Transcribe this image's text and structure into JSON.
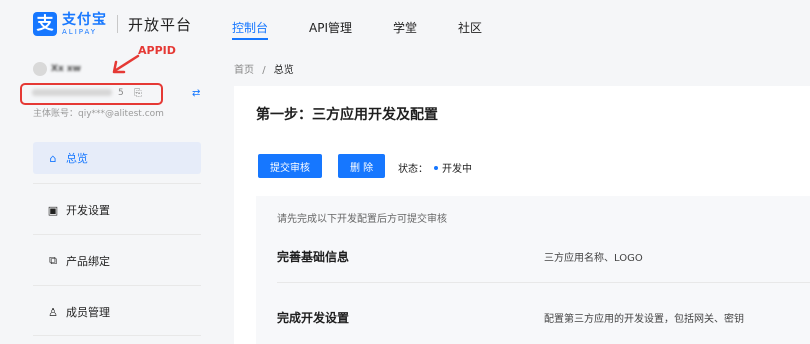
{
  "logo": {
    "cn": "支付宝",
    "en": "ALIPAY",
    "platform": "开放平台"
  },
  "nav": [
    {
      "label": "控制台",
      "active": true
    },
    {
      "label": "API管理",
      "active": false
    },
    {
      "label": "学堂",
      "active": false
    },
    {
      "label": "社区",
      "active": false
    }
  ],
  "annotation": {
    "label": "APPID"
  },
  "account": {
    "appid_suffix": "5",
    "subject": "主体账号：qiy***@alitest.com"
  },
  "menu": [
    {
      "label": "总览",
      "icon": "home-icon",
      "active": true
    },
    {
      "label": "开发设置",
      "icon": "settings-doc-icon",
      "active": false
    },
    {
      "label": "产品绑定",
      "icon": "product-link-icon",
      "active": false
    },
    {
      "label": "成员管理",
      "icon": "members-icon",
      "active": false
    }
  ],
  "breadcrumb": {
    "home": "首页",
    "sep": "/",
    "current": "总览"
  },
  "main": {
    "step_title": "第一步：三方应用开发及配置",
    "submit_label": "提交审核",
    "delete_label": "删 除",
    "status_label": "状态：",
    "status_value": "开发中",
    "note": "请先完成以下开发配置后方可提交审核",
    "tasks": [
      {
        "name": "完善基础信息",
        "desc": "三方应用名称、LOGO"
      },
      {
        "name": "完成开发设置",
        "desc": "配置第三方应用的开发设置，包括网关、密钥"
      }
    ]
  },
  "colors": {
    "accent": "#1677ff",
    "annotation": "#e53935"
  }
}
